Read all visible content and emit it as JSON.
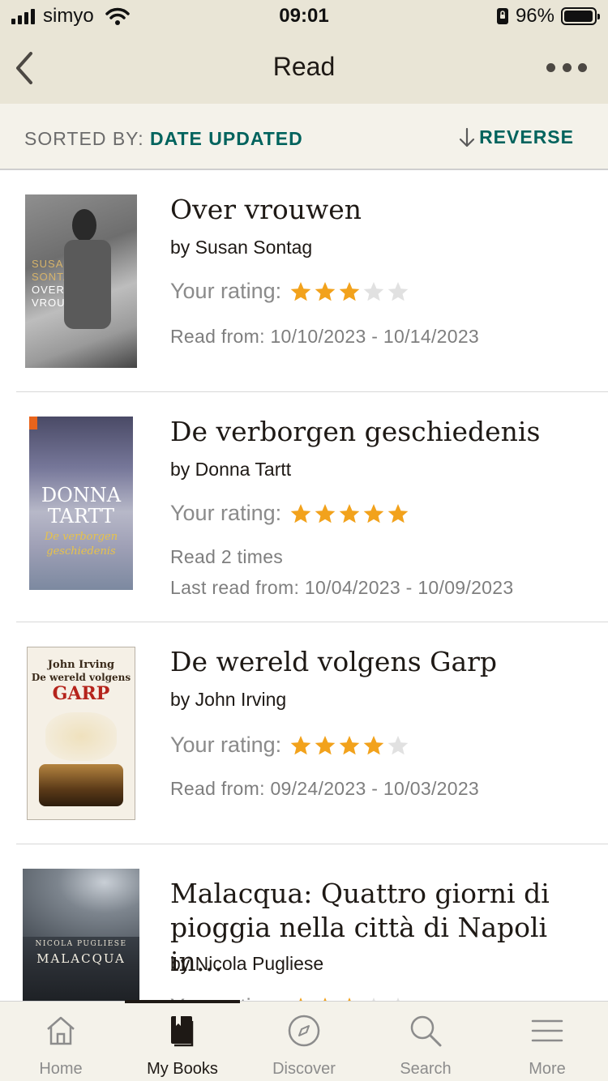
{
  "status_bar": {
    "carrier": "simyo",
    "time": "09:01",
    "battery_percent": "96%",
    "battery_level": 0.96
  },
  "nav": {
    "title": "Read",
    "back_icon": "chevron-left-icon",
    "more_icon": "ellipsis-icon"
  },
  "sort": {
    "label": "SORTED BY:",
    "value": "DATE UPDATED",
    "reverse_label": "REVERSE"
  },
  "books": [
    {
      "title": "Over vrouwen",
      "author": "by Susan Sontag",
      "rating_label": "Your rating:",
      "rating": 3,
      "read_from": "Read from: 10/10/2023 - 10/14/2023",
      "cover_text": [
        "SUSAN",
        "SONTAG",
        "OVER",
        "VROUWEN"
      ]
    },
    {
      "title": "De verborgen geschiedenis",
      "author": "by Donna Tartt",
      "rating_label": "Your rating:",
      "rating": 5,
      "read_times": "Read 2 times",
      "read_from": "Last read from: 10/04/2023 - 10/09/2023",
      "cover_text": [
        "DONNA",
        "TARTT",
        "De verborgen",
        "geschiedenis"
      ]
    },
    {
      "title": "De wereld volgens Garp",
      "author": "by John Irving",
      "rating_label": "Your rating:",
      "rating": 4,
      "read_from": "Read from: 09/24/2023 - 10/03/2023",
      "cover_text": [
        "John Irving",
        "De wereld volgens",
        "GARP"
      ]
    },
    {
      "title": "Malacqua: Quattro giorni di pioggia nella città di Napoli in…",
      "author": "by Nicola Pugliese",
      "rating_label": "Your rating:",
      "rating": 3,
      "cover_text": [
        "NICOLA PUGLIESE",
        "MALACQUA"
      ]
    }
  ],
  "tabs": [
    {
      "label": "Home",
      "icon": "home-icon"
    },
    {
      "label": "My Books",
      "icon": "book-icon",
      "active": true
    },
    {
      "label": "Discover",
      "icon": "compass-icon"
    },
    {
      "label": "Search",
      "icon": "search-icon"
    },
    {
      "label": "More",
      "icon": "menu-icon"
    }
  ],
  "colors": {
    "header_bg": "#e9e5d6",
    "sort_bg": "#f4f2ea",
    "accent": "#00635d",
    "star": "#f2a21c",
    "star_empty": "#e1e1e1"
  }
}
